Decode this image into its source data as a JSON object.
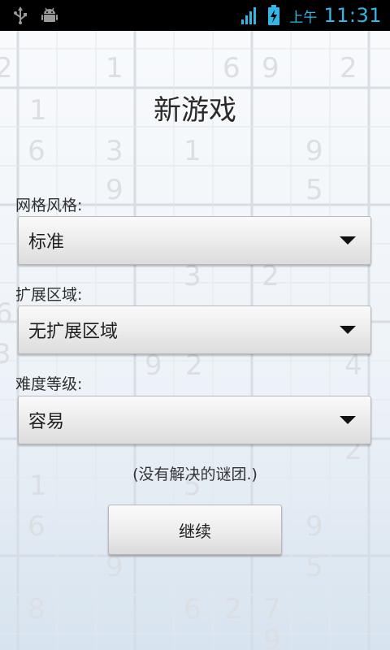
{
  "status_bar": {
    "left_icons": [
      "usb-icon",
      "android-debug-icon"
    ],
    "right_icons": [
      "signal-icon",
      "battery-charging-icon"
    ],
    "ampm": "上午",
    "time": "11:31"
  },
  "background": {
    "grid_color": "#d6dde5",
    "digits": [
      "2",
      "1",
      "6",
      "9",
      "2",
      "1",
      "6",
      "3",
      "1",
      "9",
      "9",
      "5",
      "3",
      "2",
      "6",
      "9",
      "2",
      "3",
      "4",
      "2",
      "1",
      "5",
      "6",
      "9",
      "5",
      "9",
      "8",
      "6",
      "2",
      "7",
      "9"
    ]
  },
  "screen": {
    "title": "新游戏",
    "grid_style": {
      "label": "网格风格:",
      "value": "标准"
    },
    "extended_region": {
      "label": "扩展区域:",
      "value": "无扩展区域"
    },
    "difficulty": {
      "label": "难度等级:",
      "value": "容易"
    },
    "hint": "(没有解决的谜团.)",
    "continue_label": "继续"
  }
}
